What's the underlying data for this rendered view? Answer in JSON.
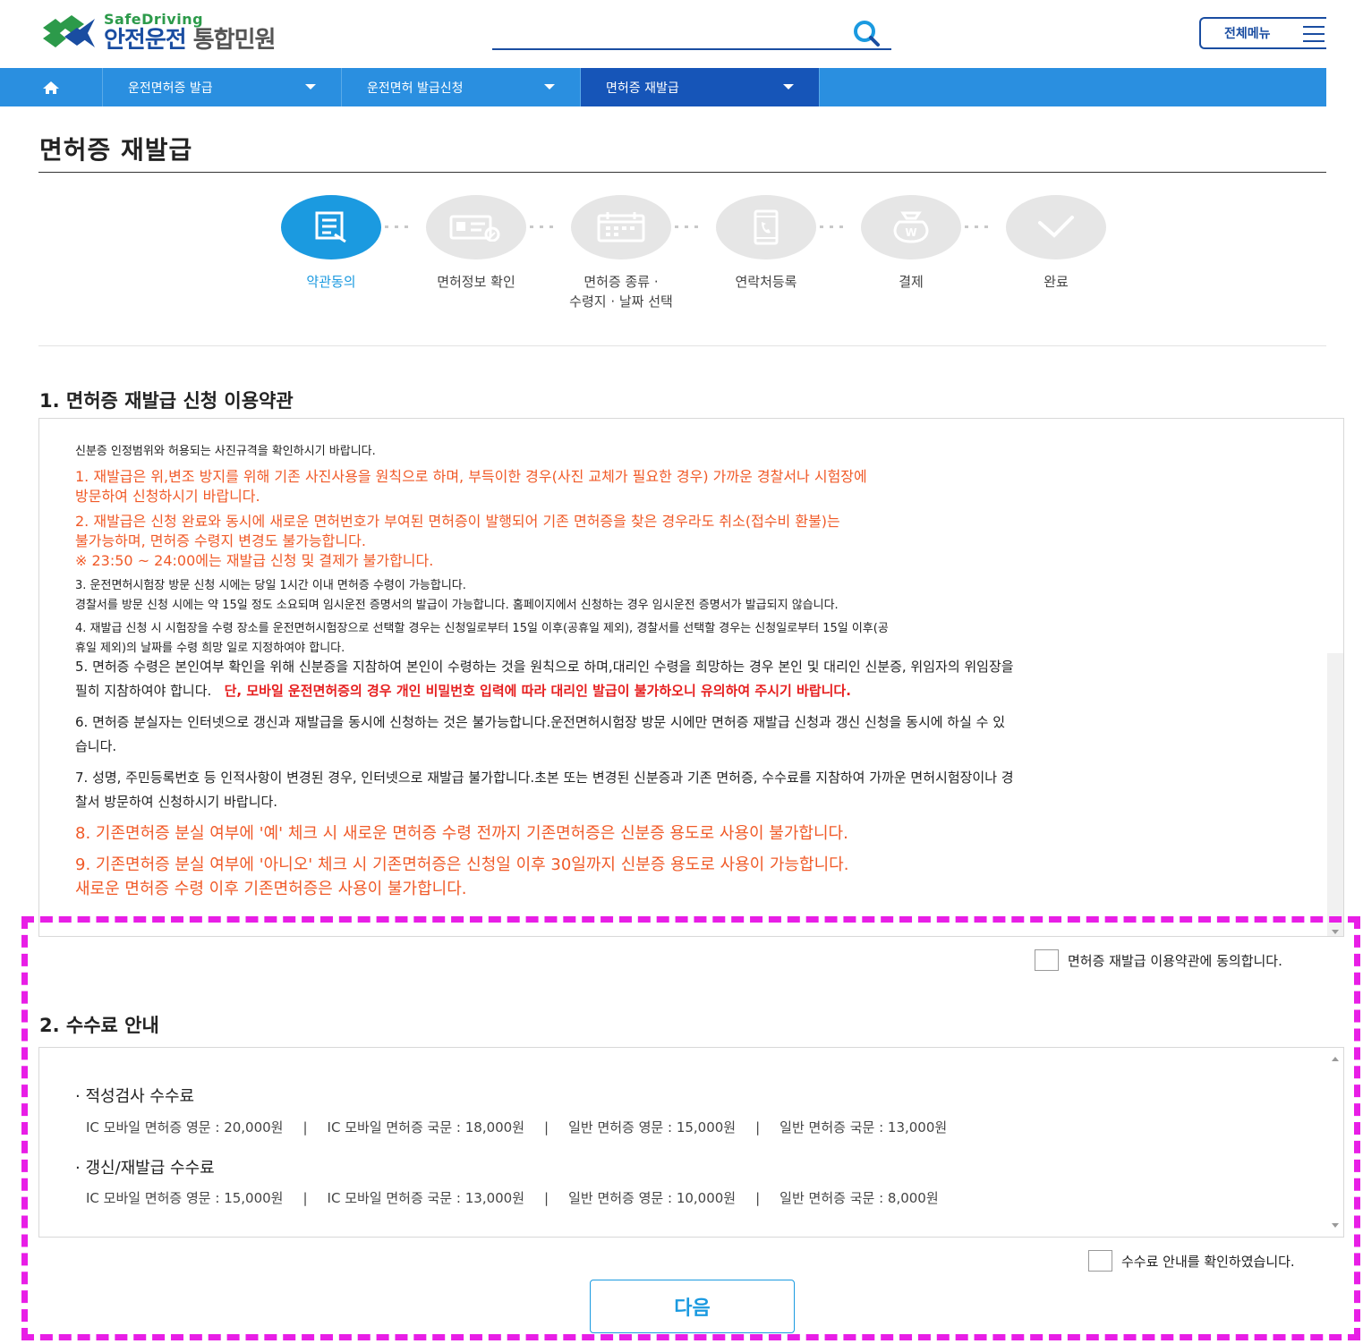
{
  "header": {
    "logo_en": "SafeDriving",
    "logo_ko_main": "안전운전",
    "logo_ko_sub": "통합민원",
    "search_placeholder": "",
    "menu_label": "전체메뉴"
  },
  "nav": {
    "items": [
      {
        "label": "운전면허증 발급"
      },
      {
        "label": "운전면허 발급신청"
      },
      {
        "label": "면허증 재발급"
      }
    ]
  },
  "page": {
    "title": "면허증 재발급"
  },
  "steps": [
    {
      "label": "약관동의",
      "active": true,
      "icon": "document-icon"
    },
    {
      "label": "면허정보 확인",
      "active": false,
      "icon": "id-card-icon"
    },
    {
      "label": "면허증 종류 ·",
      "label2": "수령지 · 날짜 선택",
      "active": false,
      "icon": "calendar-icon"
    },
    {
      "label": "연락처등록",
      "active": false,
      "icon": "phone-icon"
    },
    {
      "label": "결제",
      "active": false,
      "icon": "payment-icon"
    },
    {
      "label": "완료",
      "active": false,
      "icon": "check-icon"
    }
  ],
  "terms": {
    "title": "1. 면허증 재발급 신청 이용약관",
    "intro": "신분증 인정범위와 허용되는 사진규격을 확인하시기 바랍니다.",
    "p1": "1. 재발급은 위,변조 방지를 위해 기존 사진사용을 원칙으로 하며, 부득이한 경우(사진 교체가 필요한 경우) 가까운 경찰서나 시험장에",
    "p1b": "방문하여 신청하시기 바랍니다.",
    "p2": "2. 재발급은 신청 완료와 동시에 새로운 면허번호가 부여된 면허증이 발행되어 기존 면허증을 찾은 경우라도 취소(접수비 환불)는",
    "p2b": "불가능하며, 면허증 수령지 변경도 불가능합니다.",
    "p2c": "※ 23:50 ~ 24:00에는 재발급 신청 및 결제가 불가합니다.",
    "p3": "3. 운전면허시험장 방문 신청 시에는 당일 1시간 이내 면허증 수령이 가능합니다.",
    "p3b": "경찰서를 방문 신청 시에는 약 15일 정도 소요되며 임시운전 증명서의 발급이 가능합니다. 홈페이지에서 신청하는 경우 임시운전 증명서가 발급되지 않습니다.",
    "p4": "4. 재발급 신청 시 시험장을 수령 장소를 운전면허시험장으로 선택할 경우는 신청일로부터 15일 이후(공휴일 제외), 경찰서를 선택할 경우는 신청일로부터 15일 이후(공",
    "p4b": "휴일 제외)의 날짜를 수령 희망 일로 지정하여야 합니다.",
    "p5": "5. 면허증 수령은 본인여부 확인을 위해 신분증을 지참하여 본인이 수령하는 것을 원칙으로 하며,대리인 수령을 희망하는 경우 본인 및 대리인 신분증, 위임자의 위임장을",
    "p5b": "필히 지참하여야 합니다.",
    "p5c": "단, 모바일 운전면허증의 경우 개인 비밀번호 입력에 따라 대리인 발급이 불가하오니 유의하여 주시기 바랍니다.",
    "p6": "6. 면허증 분실자는 인터넷으로 갱신과 재발급을 동시에 신청하는 것은 불가능합니다.운전면허시험장 방문 시에만 면허증 재발급 신청과 갱신 신청을 동시에 하실 수 있",
    "p6b": "습니다.",
    "p7": "7. 성명, 주민등록번호 등 인적사항이 변경된 경우, 인터넷으로 재발급 불가합니다.초본 또는 변경된 신분증과 기존 면허증, 수수료를 지참하여 가까운 면허시험장이나 경",
    "p7b": "찰서 방문하여 신청하시기 바랍니다.",
    "p8": "8. 기존면허증 분실 여부에 '예' 체크 시 새로운 면허증 수령 전까지 기존면허증은 신분증 용도로 사용이 불가합니다.",
    "p9": "9. 기존면허증 분실 여부에 '아니오' 체크 시 기존면허증은 신청일 이후 30일까지 신분증 용도로 사용이 가능합니다.",
    "p9b": "새로운 면허증 수령 이후 기존면허증은 사용이 불가합니다.",
    "agree_label": "면허증 재발급 이용약관에 동의합니다."
  },
  "fees": {
    "title": "2. 수수료 안내",
    "aptitude_title": "· 적성검사 수수료",
    "aptitude": [
      "IC 모바일 면허증 영문 : 20,000원",
      "IC 모바일 면허증 국문 : 18,000원",
      "일반 면허증 영문 : 15,000원",
      "일반 면허증 국문 : 13,000원"
    ],
    "renew_title": "· 갱신/재발급 수수료",
    "renew": [
      "IC 모바일 면허증 영문 : 15,000원",
      "IC 모바일 면허증 국문 : 13,000원",
      "일반 면허증 영문 : 10,000원",
      "일반 면허증 국문 : 8,000원"
    ],
    "separator": "|",
    "agree_label": "수수료 안내를 확인하였습니다."
  },
  "next_button": "다음",
  "colors": {
    "primary": "#1b9ae0",
    "nav": "#2a8fe0",
    "nav_active": "#1655b8",
    "warning": "#f05a28",
    "highlight": "#e81ee6"
  }
}
